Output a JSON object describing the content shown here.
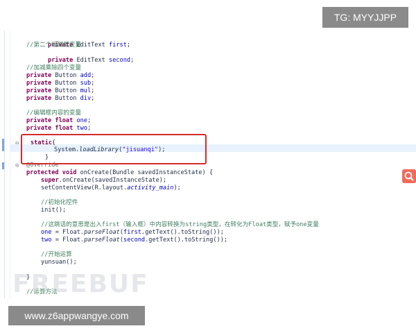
{
  "overlay": {
    "tg_label": "TG: MYYJJPP",
    "site_url": "www.z6appwangye.com",
    "watermark": "FREEBUF"
  },
  "code": {
    "l01": "private EditText first;",
    "l02": "//第二个编辑框变量",
    "l03": "private EditText second;",
    "l04": "//加减乘除四个变量",
    "l05": "private Button add;",
    "l06": "private Button sub;",
    "l07": "private Button mul;",
    "l08": "private Button div;",
    "l09": "//编辑框内容的变量",
    "l10": "private float one;",
    "l11": "private float two;",
    "l12": "static{",
    "l13": "System.loadLibrary(\"jisuanqi\");",
    "l14": "}",
    "l15": "@Override",
    "l16": "protected void onCreate(Bundle savedInstanceState) {",
    "l17": "super.onCreate(savedInstanceState);",
    "l18": "setContentView(R.layout.activity_main);",
    "l19": "//初始化控件",
    "l20": "init();",
    "l21": "//这跳话的意思是出入first（输入框）中内容转换为string类型，在转化为Float类型，赋予one变量",
    "l22": "one = Float.parseFloat(first.getText().toString());",
    "l23": "two = Float.parseFloat(second.getText().toString());",
    "l24": "//开始运算",
    "l25": "yunsuan();",
    "l26": "}",
    "l27": "//运算方法"
  },
  "colors": {
    "keyword": "#7f0055",
    "field": "#0000c0",
    "string": "#2a00ff",
    "comment": "#3f7f5f",
    "highlight_border": "#d42a2a"
  }
}
